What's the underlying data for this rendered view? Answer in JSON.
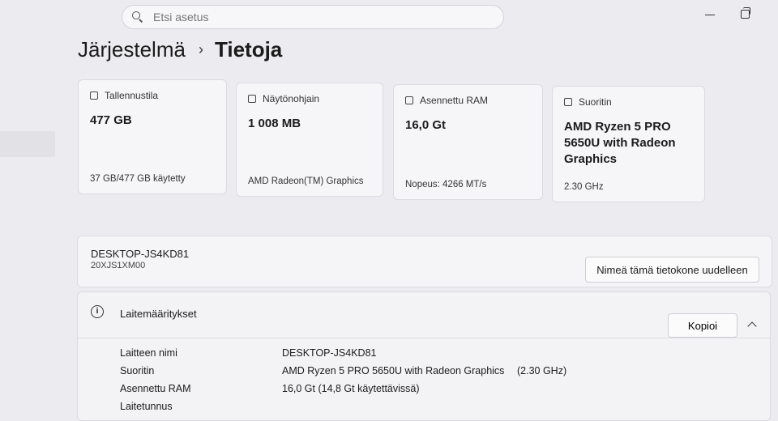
{
  "search": {
    "placeholder": "Etsi asetus"
  },
  "breadcrumb": {
    "parent": "Järjestelmä",
    "separator": "›",
    "current": "Tietoja"
  },
  "tiles": [
    {
      "icon": "storage-icon",
      "label": "Tallennustila",
      "value": "477 GB",
      "sub": "37 GB/477 GB käytetty"
    },
    {
      "icon": "display-adapter-icon",
      "label": "Näytönohjain",
      "value": "1 008 MB",
      "sub": "AMD Radeon(TM) Graphics"
    },
    {
      "icon": "ram-icon",
      "label": "Asennettu RAM",
      "value": "16,0 Gt",
      "sub": "Nopeus: 4266 MT/s"
    },
    {
      "icon": "processor-icon",
      "label": "Suoritin",
      "value": "AMD Ryzen 5 PRO 5650U with Radeon Graphics",
      "sub": "2.30 GHz"
    }
  ],
  "device": {
    "name": "DESKTOP-JS4KD81",
    "model": "20XJS1XM00",
    "rename_label": "Nimeä tämä tietokone uudelleen"
  },
  "specs": {
    "title": "Laitemääritykset",
    "copy_label": "Kopioi",
    "rows": [
      {
        "key": "Laitteen nimi",
        "value": "DESKTOP-JS4KD81",
        "extra": ""
      },
      {
        "key": "Suoritin",
        "value": "AMD Ryzen 5 PRO 5650U with Radeon Graphics",
        "extra": "(2.30 GHz)"
      },
      {
        "key": "Asennettu RAM",
        "value": "16,0 Gt (14,8 Gt käytettävissä)",
        "extra": ""
      },
      {
        "key": "Laitetunnus",
        "value": "",
        "extra": ""
      }
    ]
  }
}
